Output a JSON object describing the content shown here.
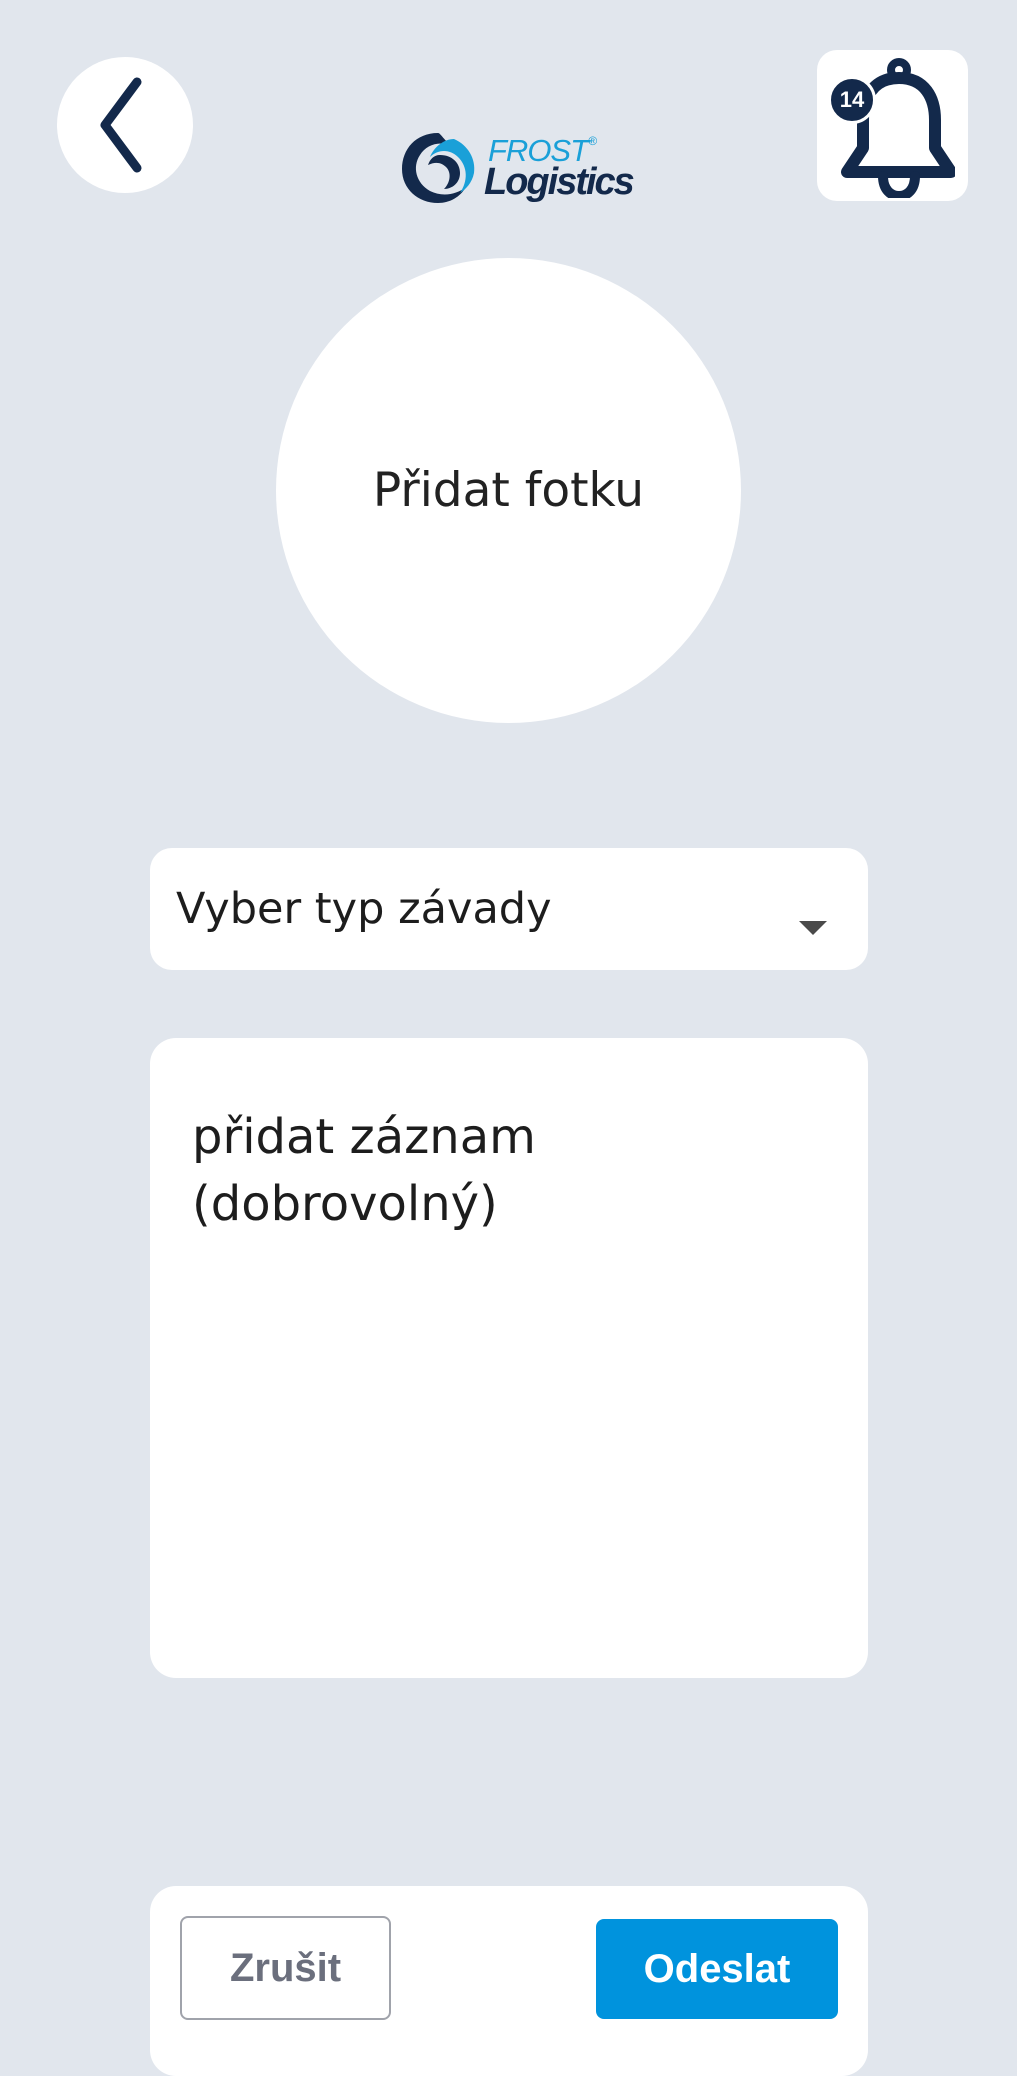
{
  "header": {
    "back_icon": "chevron-left-icon",
    "notification_icon": "bell-icon",
    "notification_count": "14",
    "logo": {
      "word_top": "FROST",
      "trademark": "®",
      "word_bottom": "Logistics",
      "colors": {
        "light": "#1aa0d8",
        "dark": "#13294b"
      }
    }
  },
  "photo": {
    "label": "Přidat fotku"
  },
  "defect_type": {
    "placeholder": "Vyber typ závady",
    "caret_icon": "caret-down-icon"
  },
  "note": {
    "placeholder": "přidat záznam (dobrovolný)"
  },
  "actions": {
    "cancel_label": "Zrušit",
    "send_label": "Odeslat",
    "send_color": "#0093dd"
  },
  "colors": {
    "background": "#e1e6ed",
    "navy": "#13294b"
  }
}
